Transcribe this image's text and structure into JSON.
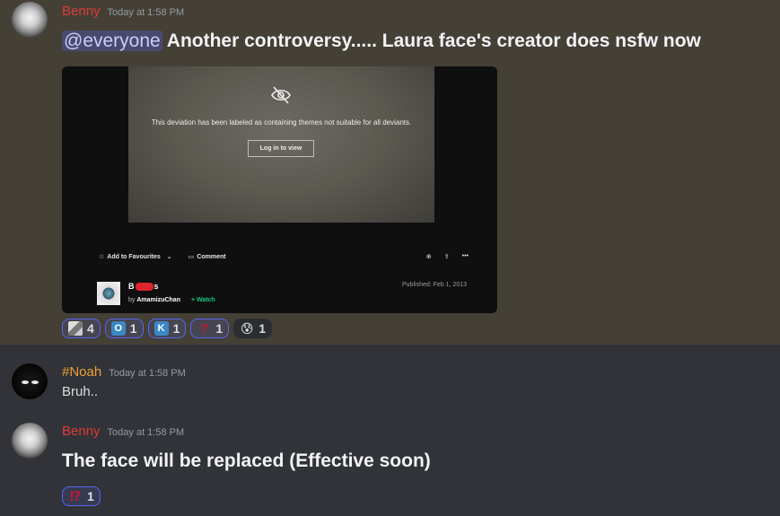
{
  "messages": [
    {
      "author": "Benny",
      "author_color": "#e03a3a",
      "timestamp": "Today at 1:58 PM",
      "mention": "@everyone",
      "text": "Another controversy..... Laura face's creator does nsfw now",
      "embed": {
        "notice": "This deviation has been labeled as containing themes not suitable for all deviants.",
        "login_button": "Log in to view",
        "actions": {
          "favourite": "Add to Favourites",
          "comment": "Comment"
        },
        "title_start": "B",
        "title_end": "s",
        "by_label": "by",
        "artist": "AmamizuChan",
        "watch": "+ Watch",
        "published": "Published: Feb 1, 2013"
      },
      "reactions": [
        {
          "emoji_name": "custom-pixel-emoji",
          "count": "4",
          "me": true
        },
        {
          "emoji_name": "regional-o",
          "glyph": "O",
          "count": "1",
          "me": true
        },
        {
          "emoji_name": "regional-k",
          "glyph": "K",
          "count": "1",
          "me": true
        },
        {
          "emoji_name": "question-mark",
          "glyph": "?",
          "count": "1",
          "me": true
        },
        {
          "emoji_name": "anxious-face",
          "glyph": "😰",
          "count": "1",
          "me": false
        }
      ]
    },
    {
      "author": "#Noah",
      "author_color": "#f0a232",
      "timestamp": "Today at 1:58 PM",
      "text": "Bruh.."
    },
    {
      "author": "Benny",
      "author_color": "#e03a3a",
      "timestamp": "Today at 1:58 PM",
      "text": "The face will be replaced (Effective soon)",
      "reactions": [
        {
          "emoji_name": "interrobang",
          "glyph": "⁉",
          "count": "1",
          "me": true
        }
      ]
    }
  ]
}
